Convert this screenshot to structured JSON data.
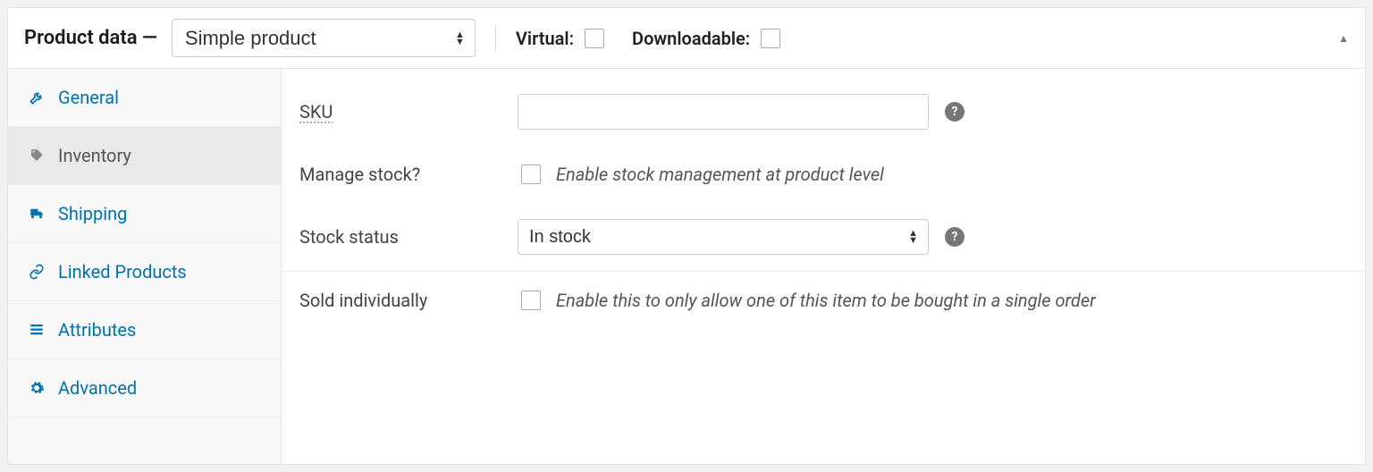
{
  "header": {
    "title": "Product data —",
    "product_type": "Simple product",
    "virtual_label": "Virtual:",
    "downloadable_label": "Downloadable:"
  },
  "tabs": {
    "general": "General",
    "inventory": "Inventory",
    "shipping": "Shipping",
    "linked": "Linked Products",
    "attributes": "Attributes",
    "advanced": "Advanced"
  },
  "panel": {
    "sku_label": "SKU",
    "sku_value": "",
    "manage_label": "Manage stock?",
    "manage_desc": "Enable stock management at product level",
    "status_label": "Stock status",
    "status_value": "In stock",
    "sold_label": "Sold individually",
    "sold_desc": "Enable this to only allow one of this item to be bought in a single order"
  }
}
